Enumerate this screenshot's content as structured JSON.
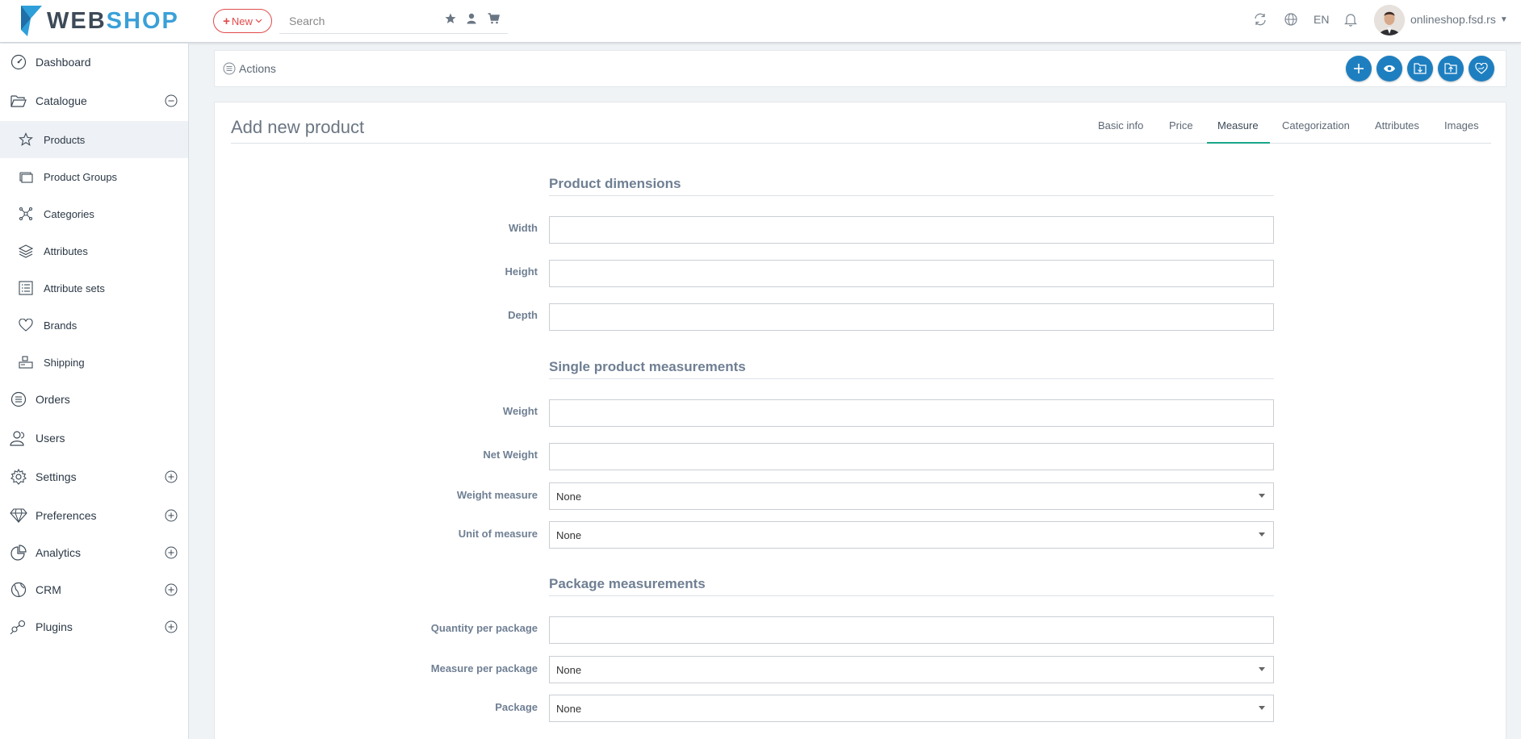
{
  "header": {
    "logo_web": "WEB",
    "logo_shop": "SHOP",
    "new_label": "New",
    "search_placeholder": "Search",
    "language": "EN",
    "account": "onlineshop.fsd.rs"
  },
  "sidebar": {
    "items": [
      {
        "label": "Dashboard"
      },
      {
        "label": "Catalogue"
      },
      {
        "label": "Orders"
      },
      {
        "label": "Users"
      },
      {
        "label": "Settings"
      },
      {
        "label": "Preferences"
      },
      {
        "label": "Analytics"
      },
      {
        "label": "CRM"
      },
      {
        "label": "Plugins"
      }
    ],
    "catalogue_sub": [
      {
        "label": "Products"
      },
      {
        "label": "Product Groups"
      },
      {
        "label": "Categories"
      },
      {
        "label": "Attributes"
      },
      {
        "label": "Attribute sets"
      },
      {
        "label": "Brands"
      },
      {
        "label": "Shipping"
      }
    ]
  },
  "actions": {
    "label": "Actions"
  },
  "page": {
    "title": "Add new product",
    "tabs": [
      {
        "label": "Basic info"
      },
      {
        "label": "Price"
      },
      {
        "label": "Measure"
      },
      {
        "label": "Categorization"
      },
      {
        "label": "Attributes"
      },
      {
        "label": "Images"
      }
    ],
    "active_tab": "Measure"
  },
  "form": {
    "dimensions": {
      "title": "Product dimensions",
      "width_label": "Width",
      "width_value": "",
      "height_label": "Height",
      "height_value": "",
      "depth_label": "Depth",
      "depth_value": ""
    },
    "single": {
      "title": "Single product measurements",
      "weight_label": "Weight",
      "weight_value": "",
      "net_weight_label": "Net Weight",
      "net_weight_value": "",
      "weight_measure_label": "Weight measure",
      "weight_measure_value": "None",
      "unit_label": "Unit of measure",
      "unit_value": "None"
    },
    "package": {
      "title": "Package measurements",
      "qty_label": "Quantity per package",
      "qty_value": "",
      "measure_label": "Measure per package",
      "measure_value": "None",
      "package_label": "Package",
      "package_value": "None"
    }
  },
  "colors": {
    "accent": "#1e7fc0",
    "tab_active": "#1aa58a",
    "new_button": "#e24a4a"
  }
}
